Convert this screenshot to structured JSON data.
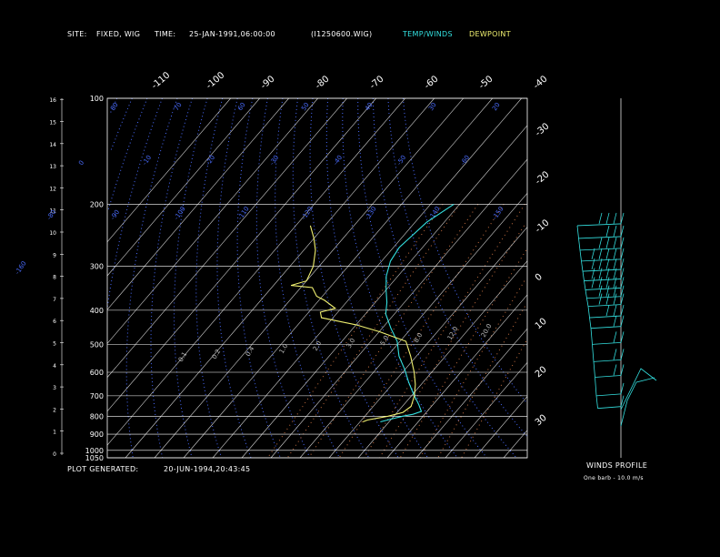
{
  "header": {
    "site_label": "SITE:",
    "site_value": "FIXED, WIG",
    "time_label": "TIME:",
    "time_value": "25-JAN-1991,06:00:00",
    "file": "(I1250600.WIG)",
    "legend_temp": "TEMP/WINDS",
    "legend_dew": "DEWPOINT"
  },
  "footer": {
    "plot_generated_label": "PLOT GENERATED:",
    "plot_generated_value": "20-JUN-1994,20:43:45",
    "winds_title": "WINDS PROFILE",
    "barb_note": "One barb - 10.0 m/s"
  },
  "colors": {
    "background": "#000000",
    "temp": "#33e0e0",
    "dewpoint": "#f0f070",
    "dry_adiabat": "#4a6cff",
    "mixing_ratio": "#c87040",
    "grid": "#ffffff"
  },
  "chart_data": {
    "type": "skew-t",
    "pressure_levels": [
      100,
      200,
      300,
      400,
      500,
      600,
      700,
      800,
      900,
      1000,
      1050
    ],
    "height_ticks": [
      0,
      1,
      2,
      3,
      4,
      5,
      6,
      7,
      8,
      9,
      10,
      11,
      12,
      13,
      14,
      15,
      16
    ],
    "isotherm_top_labels": [
      "-110",
      "-100",
      "-90",
      "-80",
      "-70",
      "-60",
      "-50",
      "-40"
    ],
    "isotherm_right_labels": [
      "-30",
      "-20",
      "-10",
      "0",
      "10",
      "20",
      "30"
    ],
    "adiabat_labels": [
      "80",
      "70",
      "60",
      "50",
      "40",
      "30",
      "20",
      "10",
      "0",
      "-10",
      "-20",
      "-30",
      "-40",
      "-50",
      "-60",
      "-70",
      "-80",
      "-90",
      "-100",
      "-110",
      "-120",
      "-130",
      "-140",
      "-150",
      "-160"
    ],
    "mixing_ratio_labels": [
      "0.1",
      "0.2",
      "0.4",
      "1.0",
      "2.0",
      "3.0",
      "5.0",
      "8.0",
      "12.0",
      "20.0"
    ],
    "temperature": [
      {
        "p": 200,
        "t": -52
      },
      {
        "p": 225,
        "t": -56
      },
      {
        "p": 245,
        "t": -57
      },
      {
        "p": 265,
        "t": -58
      },
      {
        "p": 290,
        "t": -57
      },
      {
        "p": 320,
        "t": -54
      },
      {
        "p": 350,
        "t": -50
      },
      {
        "p": 380,
        "t": -46
      },
      {
        "p": 410,
        "t": -43
      },
      {
        "p": 450,
        "t": -37
      },
      {
        "p": 490,
        "t": -31
      },
      {
        "p": 540,
        "t": -26
      },
      {
        "p": 590,
        "t": -20
      },
      {
        "p": 640,
        "t": -15
      },
      {
        "p": 690,
        "t": -10
      },
      {
        "p": 740,
        "t": -5
      },
      {
        "p": 775,
        "t": -2
      },
      {
        "p": 790,
        "t": -4
      },
      {
        "p": 800,
        "t": -7
      },
      {
        "p": 815,
        "t": -10
      },
      {
        "p": 830,
        "t": -13
      }
    ],
    "dewpoint": [
      {
        "p": 230,
        "t": -95
      },
      {
        "p": 250,
        "t": -90
      },
      {
        "p": 270,
        "t": -86
      },
      {
        "p": 300,
        "t": -82
      },
      {
        "p": 330,
        "t": -80
      },
      {
        "p": 340,
        "t": -84
      },
      {
        "p": 345,
        "t": -76
      },
      {
        "p": 365,
        "t": -72
      },
      {
        "p": 375,
        "t": -68
      },
      {
        "p": 395,
        "t": -62
      },
      {
        "p": 405,
        "t": -66
      },
      {
        "p": 420,
        "t": -64
      },
      {
        "p": 440,
        "t": -50
      },
      {
        "p": 460,
        "t": -40
      },
      {
        "p": 490,
        "t": -28
      },
      {
        "p": 540,
        "t": -22
      },
      {
        "p": 600,
        "t": -16
      },
      {
        "p": 650,
        "t": -12
      },
      {
        "p": 700,
        "t": -9
      },
      {
        "p": 750,
        "t": -7
      },
      {
        "p": 780,
        "t": -8
      },
      {
        "p": 800,
        "t": -12
      },
      {
        "p": 820,
        "t": -18
      },
      {
        "p": 830,
        "t": -19
      }
    ],
    "winds": [
      {
        "p": 230,
        "barbs": 4
      },
      {
        "p": 250,
        "barbs": 3
      },
      {
        "p": 270,
        "barbs": 4
      },
      {
        "p": 290,
        "barbs": 5
      },
      {
        "p": 310,
        "barbs": 5
      },
      {
        "p": 330,
        "barbs": 5
      },
      {
        "p": 350,
        "barbs": 5
      },
      {
        "p": 370,
        "barbs": 4
      },
      {
        "p": 390,
        "barbs": 4
      },
      {
        "p": 420,
        "barbs": 3
      },
      {
        "p": 450,
        "barbs": 2
      },
      {
        "p": 500,
        "barbs": 2
      },
      {
        "p": 560,
        "barbs": 2
      },
      {
        "p": 620,
        "barbs": 2
      },
      {
        "p": 700,
        "barbs": 1
      },
      {
        "p": 760,
        "barbs": 1
      }
    ],
    "xlabel": "",
    "ylabel": ""
  }
}
